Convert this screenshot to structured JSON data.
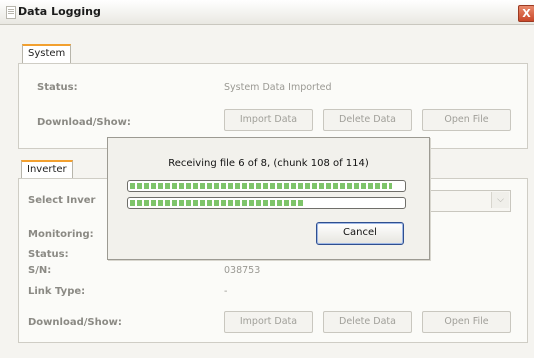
{
  "window": {
    "title": "Data Logging",
    "close_glyph": "X"
  },
  "system": {
    "tab_label": "System",
    "status_label": "Status:",
    "status_value": "System Data Imported",
    "download_label": "Download/Show:",
    "buttons": {
      "import": "Import Data",
      "delete": "Delete Data",
      "open": "Open File"
    }
  },
  "inverter": {
    "tab_label": "Inverter",
    "select_label": "Select Inver",
    "select_arrow": "⌵",
    "monitoring_label": "Monitoring:",
    "status_label": "Status:",
    "sn_label": "S/N:",
    "sn_value": "038753",
    "link_type_label": "Link Type:",
    "link_type_value": "-",
    "download_label": "Download/Show:",
    "buttons": {
      "import": "Import Data",
      "delete": "Delete Data",
      "open": "Open File"
    }
  },
  "progress_dialog": {
    "message": "Receiving file 6 of 8, (chunk 108 of 114)",
    "bar1_fraction": 0.96,
    "bar2_fraction": 0.64,
    "cancel_label": "Cancel"
  },
  "colors": {
    "accent_tab": "#f2a02f",
    "progress_green": "#7ec46a",
    "close_red": "#c9482a"
  }
}
